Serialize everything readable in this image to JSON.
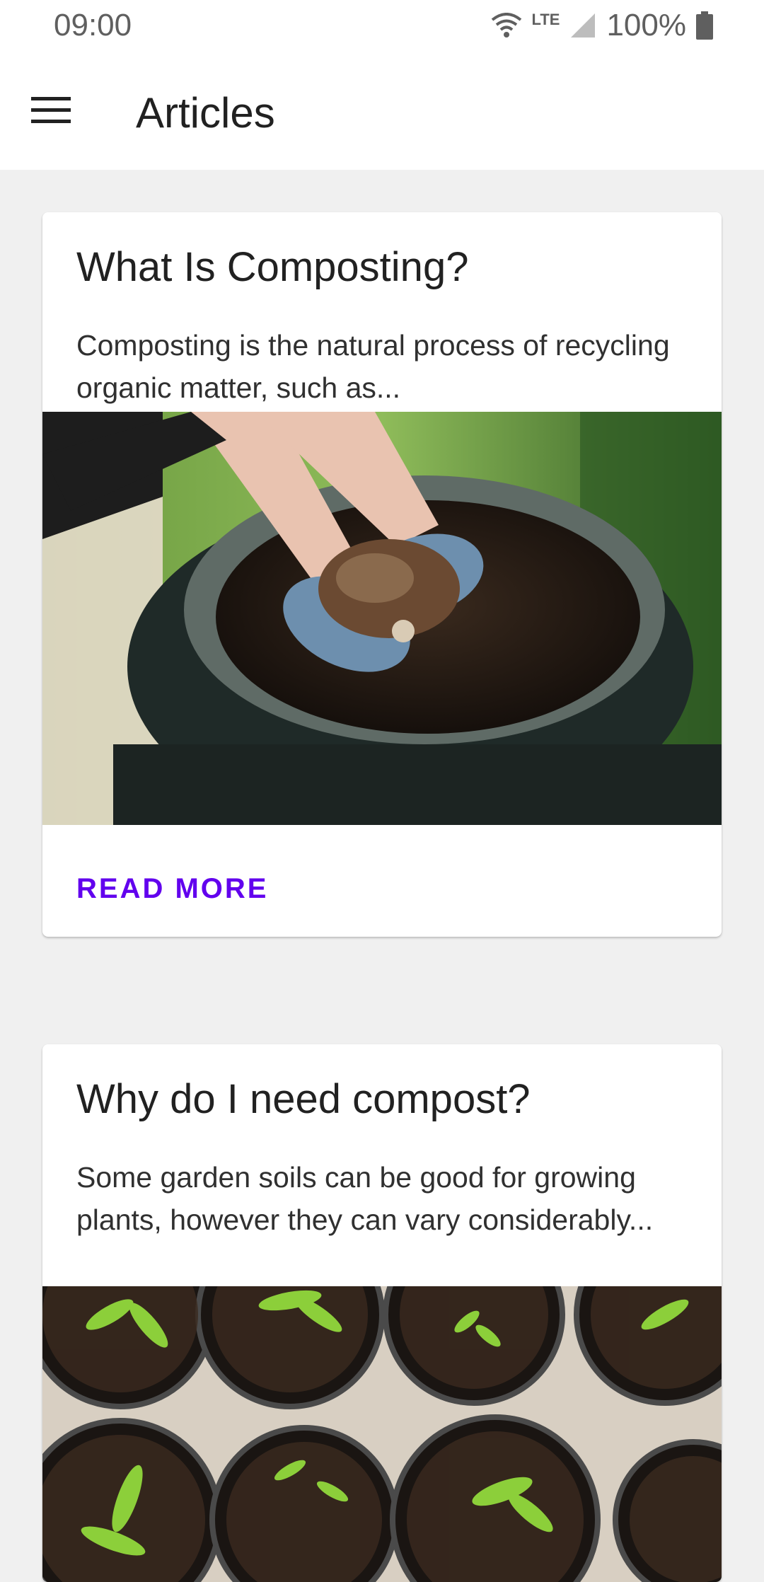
{
  "status_bar": {
    "time": "09:00",
    "network": "LTE",
    "battery": "100%",
    "icons": [
      "wifi-icon",
      "signal-icon",
      "battery-icon"
    ]
  },
  "app_bar": {
    "menu_icon": "menu-icon",
    "title": "Articles"
  },
  "articles": [
    {
      "title": "What Is Composting?",
      "description": "Composting is the natural process of recycling organic matter, such as...",
      "image": "hands-holding-compost-over-bin",
      "action": "READ MORE"
    },
    {
      "title": "Why do I need compost?",
      "description": "Some garden soils can be good for growing plants, however they can vary considerably...",
      "image": "seedlings-in-pots"
    }
  ],
  "colors": {
    "accent": "#6200ee",
    "background": "#f0f0f0",
    "surface": "#ffffff",
    "text": "#212121"
  }
}
